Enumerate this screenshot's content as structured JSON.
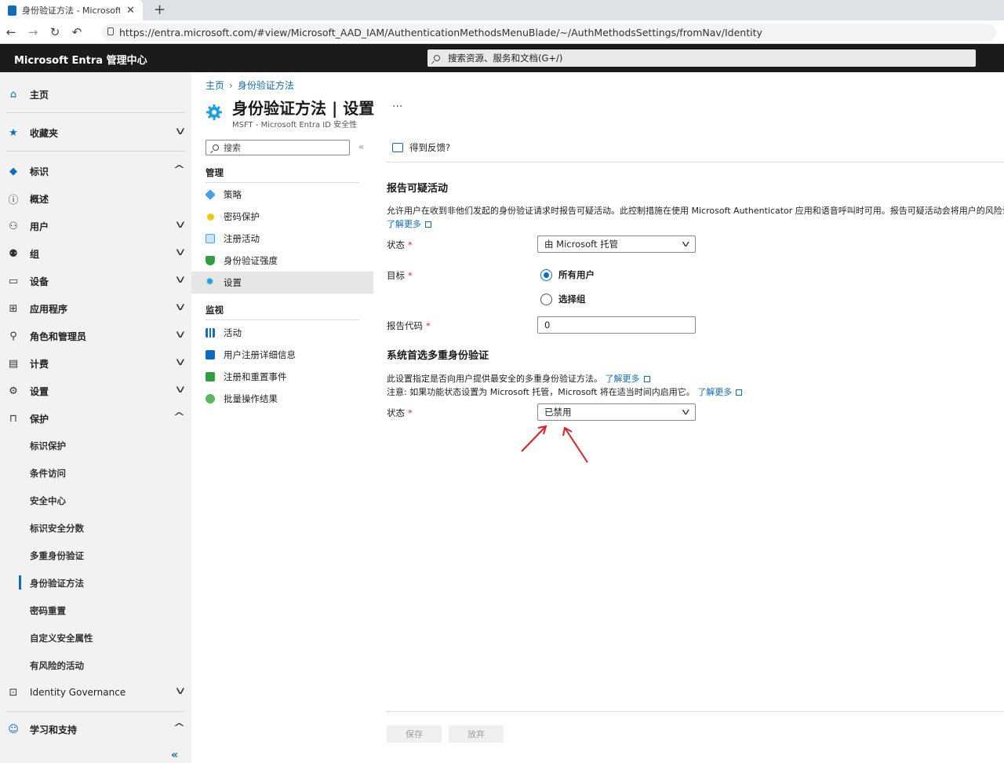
{
  "browser": {
    "tab_title": "身份验证方法 - Microsoft E",
    "tab_close": "✕",
    "new_tab": "+",
    "url": "https://entra.microsoft.com/#view/Microsoft_AAD_IAM/AuthenticationMethodsMenuBlade/~/AuthMethodsSettings/fromNav/Identity"
  },
  "topbar": {
    "brand": "Microsoft Entra 管理中心",
    "search_placeholder": "搜索资源、服务和文档(G+/)"
  },
  "leftnav": {
    "home": "主页",
    "favorites": "收藏夹",
    "identity": "标识",
    "overview": "概述",
    "users": "用户",
    "groups": "组",
    "devices": "设备",
    "apps": "应用程序",
    "roles": "角色和管理员",
    "billing": "计费",
    "settings": "设置",
    "protection": "保护",
    "protection_items": [
      "标识保护",
      "条件访问",
      "安全中心",
      "标识安全分数",
      "多重身份验证",
      "身份验证方法",
      "密码重置",
      "自定义安全属性",
      "有风险的活动"
    ],
    "identity_governance": "Identity Governance",
    "learn_support": "学习和支持",
    "collapse": "«"
  },
  "breadcrumb": {
    "home": "主页",
    "current": "身份验证方法"
  },
  "page": {
    "title": "身份验证方法 | 设置",
    "subtitle": "MSFT - Microsoft Entra ID 安全性",
    "more": "···"
  },
  "submenu": {
    "search_placeholder": "搜索",
    "collapse": "«",
    "manage_header": "管理",
    "manage_items": [
      "策略",
      "密码保护",
      "注册活动",
      "身份验证强度",
      "设置"
    ],
    "monitor_header": "监视",
    "monitor_items": [
      "活动",
      "用户注册详细信息",
      "注册和重置事件",
      "批量操作结果"
    ]
  },
  "content": {
    "feedback": "得到反馈?",
    "report_title": "报告可疑活动",
    "report_desc": "允许用户在收到非他们发起的身份验证请求时报告可疑活动。此控制措施在使用 Microsoft Authenticator 应用和语音呼叫时可用。报告可疑活动会将用户的风险设",
    "learn_more": "了解更多",
    "state_label": "状态",
    "state_value": "由 Microsoft 托管",
    "target_label": "目标",
    "target_all": "所有用户",
    "target_select": "选择组",
    "report_code_label": "报告代码",
    "report_code_value": "0",
    "mfa_title": "系统首选多重身份验证",
    "mfa_desc1": "此设置指定是否向用户提供最安全的多重身份验证方法。",
    "mfa_desc2": "注意: 如果功能状态设置为 Microsoft 托管，Microsoft 将在适当时间内启用它。",
    "mfa_state_label": "状态",
    "mfa_state_value": "已禁用",
    "required_mark": "*",
    "save": "保存",
    "discard": "放弃"
  },
  "colors": {
    "accent": "#0f6cbd",
    "topbar_bg": "#1b1b1b",
    "nav_bg": "#f2f2f2",
    "annotation_arrow": "#e02020"
  }
}
